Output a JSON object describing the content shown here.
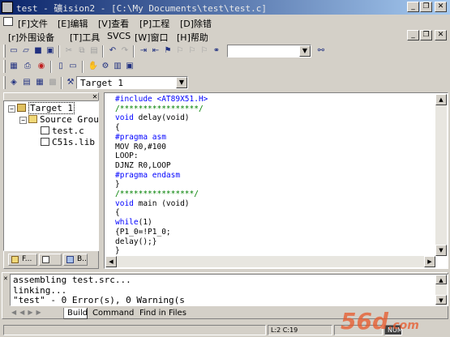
{
  "window": {
    "title": "test  - 礦ision2 - [C:\\My Documents\\test\\test.c]",
    "min": "_",
    "restore": "❐",
    "close": "✕"
  },
  "menu1": [
    {
      "label": "[F]文件"
    },
    {
      "label": "[E]编辑"
    },
    {
      "label": "[V]查看"
    },
    {
      "label": "[P]工程"
    },
    {
      "label": "[D]除错"
    }
  ],
  "menu2": [
    {
      "label": "[r]外围设备"
    },
    {
      "label": "[T]工具"
    },
    {
      "label": "SVCS"
    },
    {
      "label": "[W]窗口"
    },
    {
      "label": "[H]帮助"
    }
  ],
  "mdi": {
    "min": "_",
    "restore": "❐",
    "close": "✕"
  },
  "toolbar": {
    "find_combo_value": "",
    "target_combo_value": "Target 1"
  },
  "project": {
    "close": "✕",
    "tree": [
      {
        "label": "Target 1"
      },
      {
        "label": "Source Grou"
      },
      {
        "label": "test.c"
      },
      {
        "label": "C51s.lib"
      }
    ],
    "tabs": [
      {
        "label": "F..."
      },
      {
        "label": ""
      },
      {
        "label": "B..."
      }
    ]
  },
  "editor": {
    "lines": [
      "#include <AT89X51.H>",
      "/*****************/",
      "void delay(void)",
      "{",
      "#pragma asm",
      "MOV R0,#100",
      "LOOP:",
      "DJNZ R0,LOOP",
      "#pragma endasm",
      "}",
      "/****************/",
      "void main (void)",
      "{",
      "while(1)",
      "{P1_0=!P1_0;",
      "delay();}",
      "}"
    ]
  },
  "output": {
    "lines": [
      "assembling test.src...",
      "linking...",
      "\"test\" - 0 Error(s), 0 Warning(s"
    ],
    "tabs": [
      {
        "label": "Build"
      },
      {
        "label": "Command"
      },
      {
        "label": "Find in Files"
      }
    ]
  },
  "status": {
    "position": "L:2 C:19",
    "flags": [
      "NUM"
    ]
  },
  "watermark": {
    "brand": "56d",
    "suffix": ".com"
  },
  "colors": {
    "titlebar_start": "#0a246a",
    "titlebar_end": "#a6caf0",
    "keyword": "#0000ff",
    "comment": "#008000",
    "watermark": "#e8582a"
  }
}
